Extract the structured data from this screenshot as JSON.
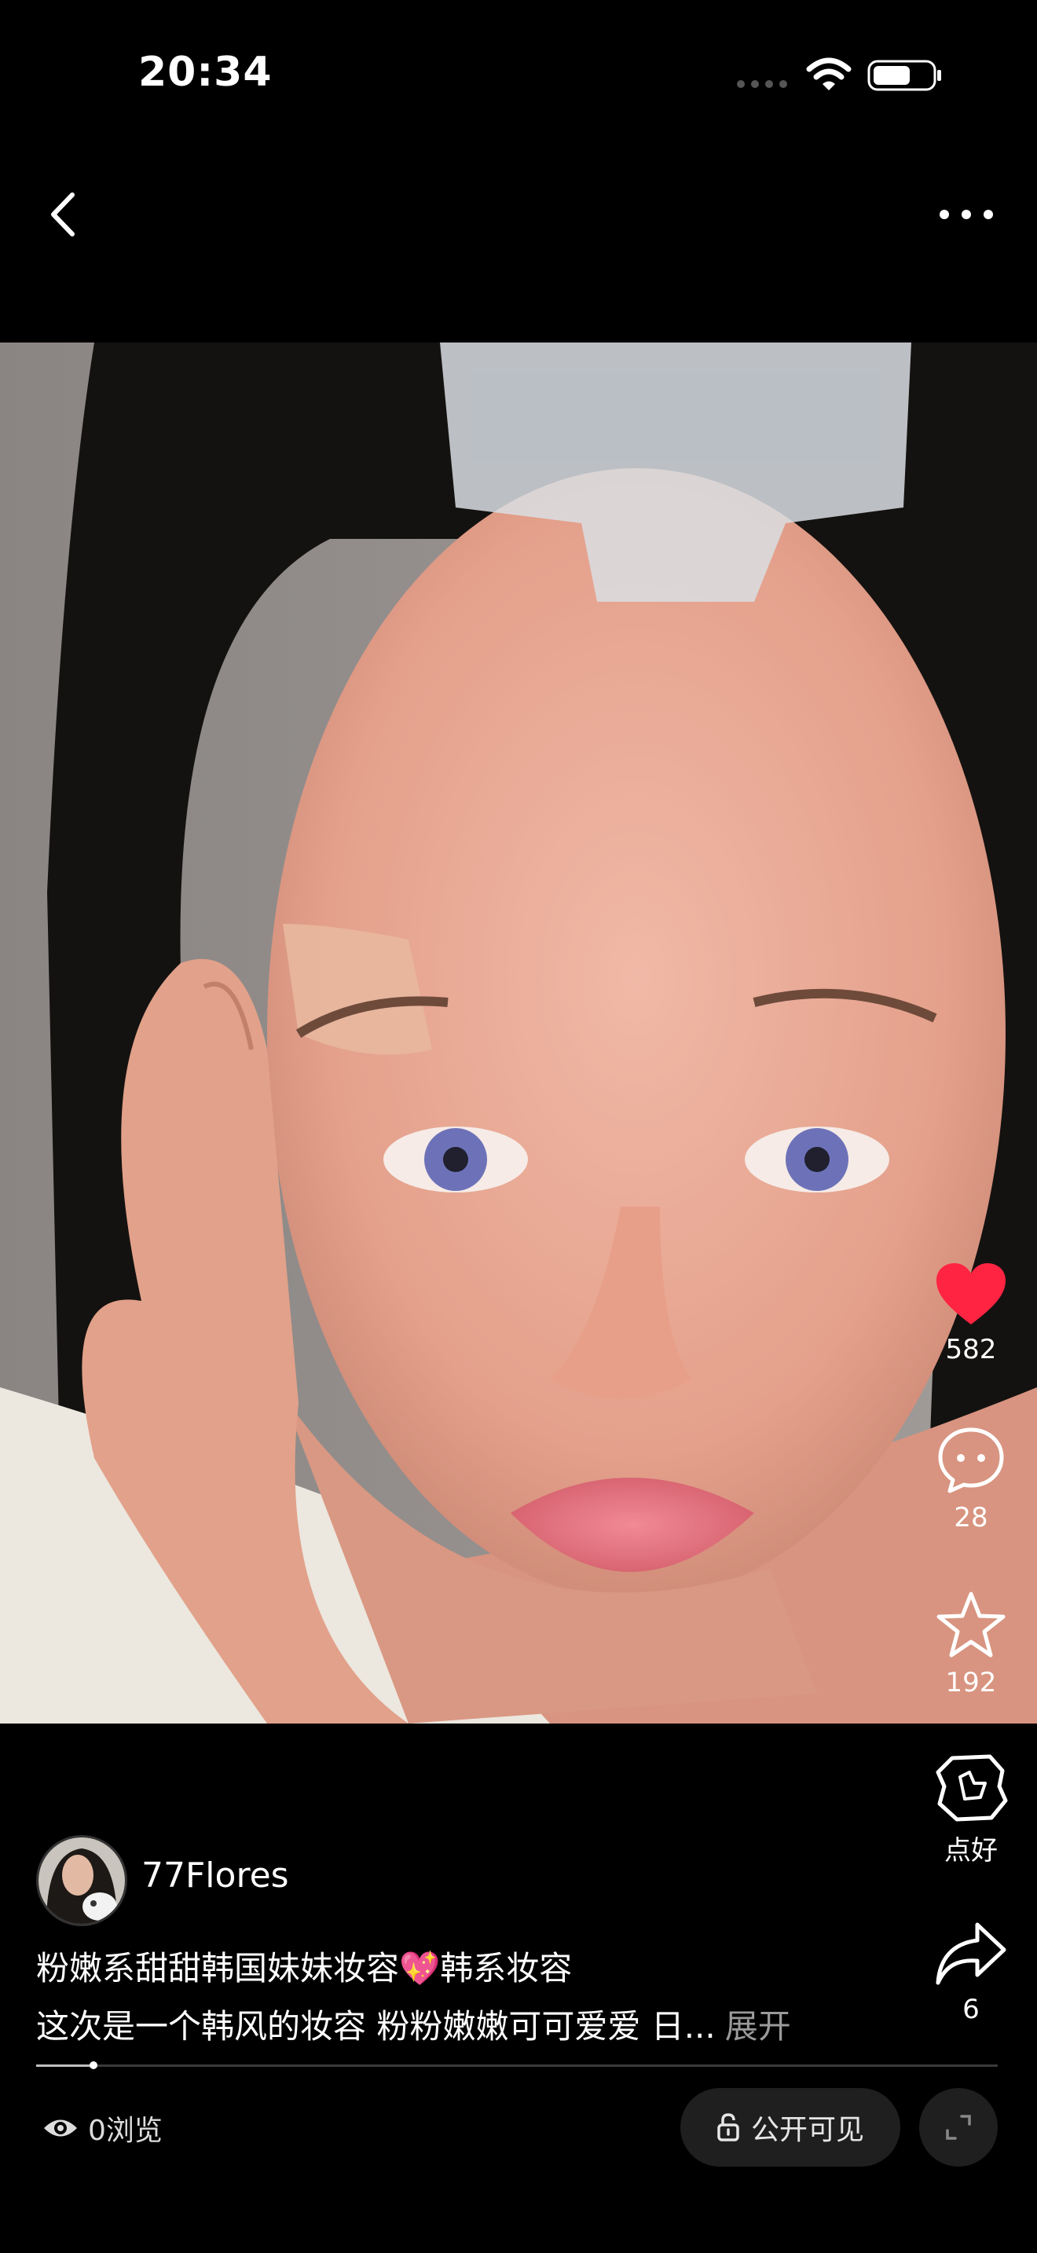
{
  "status_bar": {
    "time": "20:34"
  },
  "video": {
    "description_icon": "makeup-video-frame"
  },
  "actions": {
    "like": {
      "count": "582",
      "icon": "heart-icon",
      "color": "#ff2442"
    },
    "comment": {
      "count": "28",
      "icon": "comment-icon"
    },
    "collect": {
      "count": "192",
      "icon": "star-icon"
    },
    "dianhao": {
      "label": "点好",
      "icon": "thumb-badge-icon"
    },
    "share": {
      "count": "6",
      "icon": "share-icon"
    }
  },
  "author": {
    "name": "77Flores"
  },
  "caption": {
    "title": "粉嫩系甜甜韩国妹妹妆容💖韩系妆容",
    "body": "这次是一个韩风的妆容 粉粉嫩嫩可可爱爱 日...",
    "expand": "展开"
  },
  "progress": {
    "fraction": 0.06
  },
  "footer": {
    "views": "0浏览",
    "visibility": "公开可见"
  }
}
